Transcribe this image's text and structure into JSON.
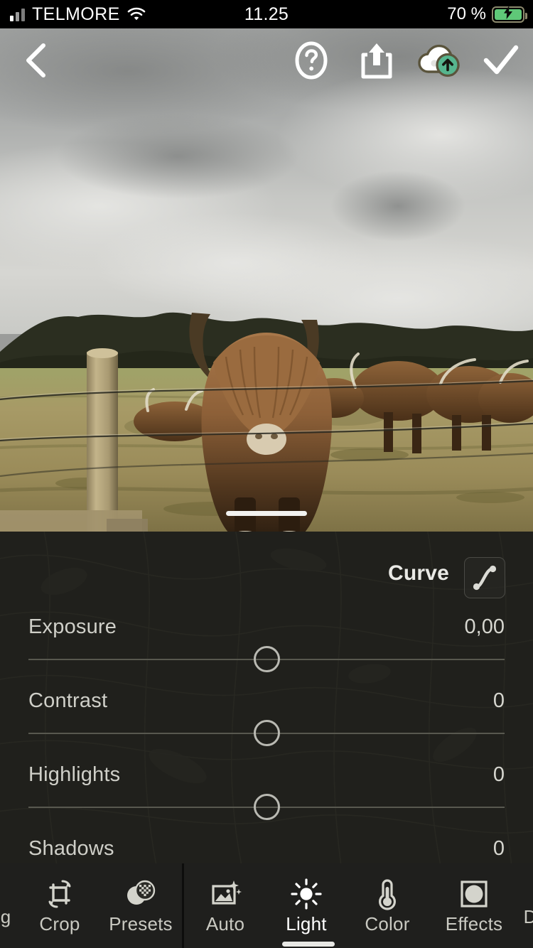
{
  "status_bar": {
    "carrier": "TELMORE",
    "time": "11.25",
    "battery_percent": "70 %",
    "signal_icon": "signal-bars-icon",
    "wifi_icon": "wifi-icon",
    "battery_icon": "battery-charging-icon"
  },
  "toolbar": {
    "back_icon": "chevron-left-icon",
    "help_icon": "question-mark-circle-icon",
    "share_icon": "share-upload-icon",
    "cloud_icon": "cloud-upload-icon",
    "done_icon": "checkmark-icon",
    "accent_green": "#56b58e"
  },
  "photo": {
    "alt_name": "highland-cattle-in-field-photo",
    "sky_top_color": "#a4a6a5",
    "sky_bottom_color": "#d9d9d6",
    "grass_color": "#a79a6c",
    "treeline_color": "#2e3122",
    "cow_color": "#8d6038"
  },
  "panel": {
    "curve_label": "Curve",
    "curve_icon": "tone-curve-icon",
    "sliders": [
      {
        "name": "Exposure",
        "value": "0,00",
        "position_percent": 50
      },
      {
        "name": "Contrast",
        "value": "0",
        "position_percent": 50
      },
      {
        "name": "Highlights",
        "value": "0",
        "position_percent": 50
      },
      {
        "name": "Shadows",
        "value": "0",
        "position_percent": 50
      }
    ]
  },
  "bottom_bar": {
    "edge_left_partial": "g",
    "edge_right_partial": "D",
    "items": [
      {
        "label": "Crop",
        "icon": "crop-rotate-icon",
        "active": false
      },
      {
        "label": "Presets",
        "icon": "presets-icon",
        "active": false
      },
      {
        "label": "Auto",
        "icon": "auto-enhance-icon",
        "active": false
      },
      {
        "label": "Light",
        "icon": "sun-brightness-icon",
        "active": true
      },
      {
        "label": "Color",
        "icon": "thermometer-icon",
        "active": false
      },
      {
        "label": "Effects",
        "icon": "effects-vignette-icon",
        "active": false
      }
    ]
  }
}
